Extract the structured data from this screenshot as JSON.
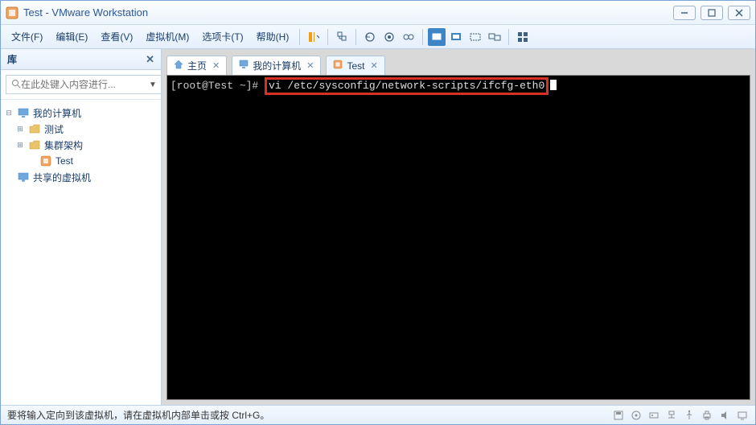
{
  "title": "Test - VMware Workstation",
  "menu": {
    "file": "文件(F)",
    "edit": "编辑(E)",
    "view": "查看(V)",
    "vm": "虚拟机(M)",
    "tabs": "选项卡(T)",
    "help": "帮助(H)"
  },
  "sidebar": {
    "header": "库",
    "search_placeholder": "在此处键入内容进行...",
    "items": {
      "mycomputer": "我的计算机",
      "test_folder": "测试",
      "cluster": "集群架构",
      "test_vm": "Test",
      "shared": "共享的虚拟机"
    }
  },
  "tabs": {
    "home": "主页",
    "mycomputer": "我的计算机",
    "test": "Test"
  },
  "terminal": {
    "prompt": "[root@Test ~]# ",
    "command": "vi /etc/sysconfig/network-scripts/ifcfg-eth0"
  },
  "statusbar": {
    "text": "要将输入定向到该虚拟机，请在虚拟机内部单击或按 Ctrl+G。"
  }
}
